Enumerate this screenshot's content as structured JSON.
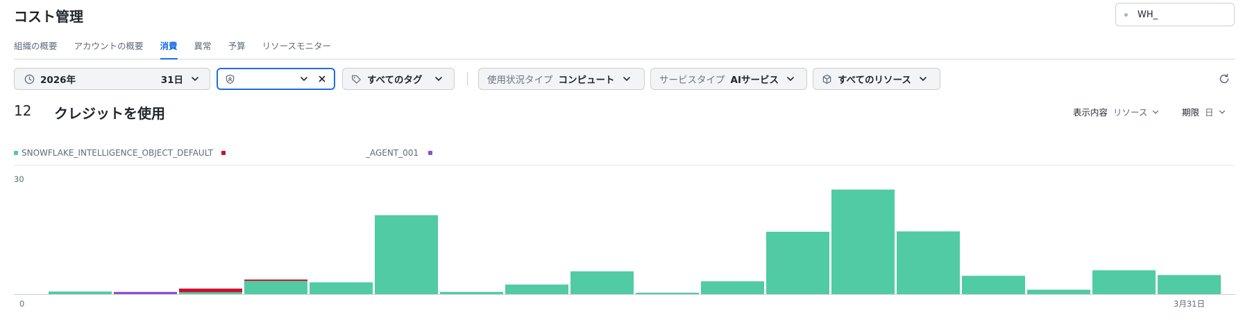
{
  "page": {
    "title": "コスト管理"
  },
  "warehouse": {
    "value": "WH_"
  },
  "tabs": [
    {
      "label": "組織の概要",
      "active": false
    },
    {
      "label": "アカウントの概要",
      "active": false
    },
    {
      "label": "消費",
      "active": true
    },
    {
      "label": "異常",
      "active": false
    },
    {
      "label": "予算",
      "active": false
    },
    {
      "label": "リソースモニター",
      "active": false
    }
  ],
  "filters": {
    "date_year": "2026年",
    "date_day": "31日",
    "role_value": "",
    "tags": "すべてのタグ",
    "usage_label": "使用状況タイプ",
    "usage_value": "コンピュート",
    "service_label": "サービスタイプ",
    "service_value": "AIサービス",
    "resources": "すべてのリソース"
  },
  "summary": {
    "credits": "12",
    "label": "クレジットを使用"
  },
  "view": {
    "label": "表示内容",
    "value": "リソース"
  },
  "period": {
    "label": "期限",
    "value": "日"
  },
  "colors": {
    "accent": "#1a6ce7",
    "green": "#50cba4",
    "red": "#c8102e",
    "purple": "#8a4fd8"
  },
  "chart_data": {
    "type": "bar",
    "stacked": true,
    "ylim": [
      0,
      30
    ],
    "y_ticks": [
      "0",
      "30"
    ],
    "x_tick_labels": [
      {
        "index": 17,
        "label": "3月31日"
      }
    ],
    "legend": [
      {
        "name": "SNOWFLAKE_INTELLIGENCE_OBJECT_DEFAULT",
        "color": "#50cba4"
      },
      {
        "name": "",
        "color": "#c8102e"
      },
      {
        "name": "_AGENT_001",
        "color": "#8a4fd8"
      }
    ],
    "series": [
      {
        "name": "SNOWFLAKE_INTELLIGENCE_OBJECT_DEFAULT",
        "color": "#50cba4",
        "values": [
          0.7,
          0,
          0.5,
          3.6,
          3.2,
          21.5,
          0.6,
          2.6,
          6.2,
          0.3,
          3.5,
          17.0,
          28.5,
          17.1,
          5.0,
          1.2,
          6.5,
          5.2
        ]
      },
      {
        "name": "",
        "color": "#c8102e",
        "values": [
          0,
          0,
          1.0,
          0.3,
          0,
          0,
          0,
          0,
          0,
          0,
          0,
          0,
          0,
          0,
          0,
          0,
          0,
          0
        ]
      },
      {
        "name": "_AGENT_001",
        "color": "#8a4fd8",
        "values": [
          0,
          0.6,
          0,
          0,
          0,
          0,
          0,
          0,
          0,
          0,
          0,
          0,
          0,
          0,
          0,
          0,
          0,
          0
        ]
      }
    ]
  }
}
